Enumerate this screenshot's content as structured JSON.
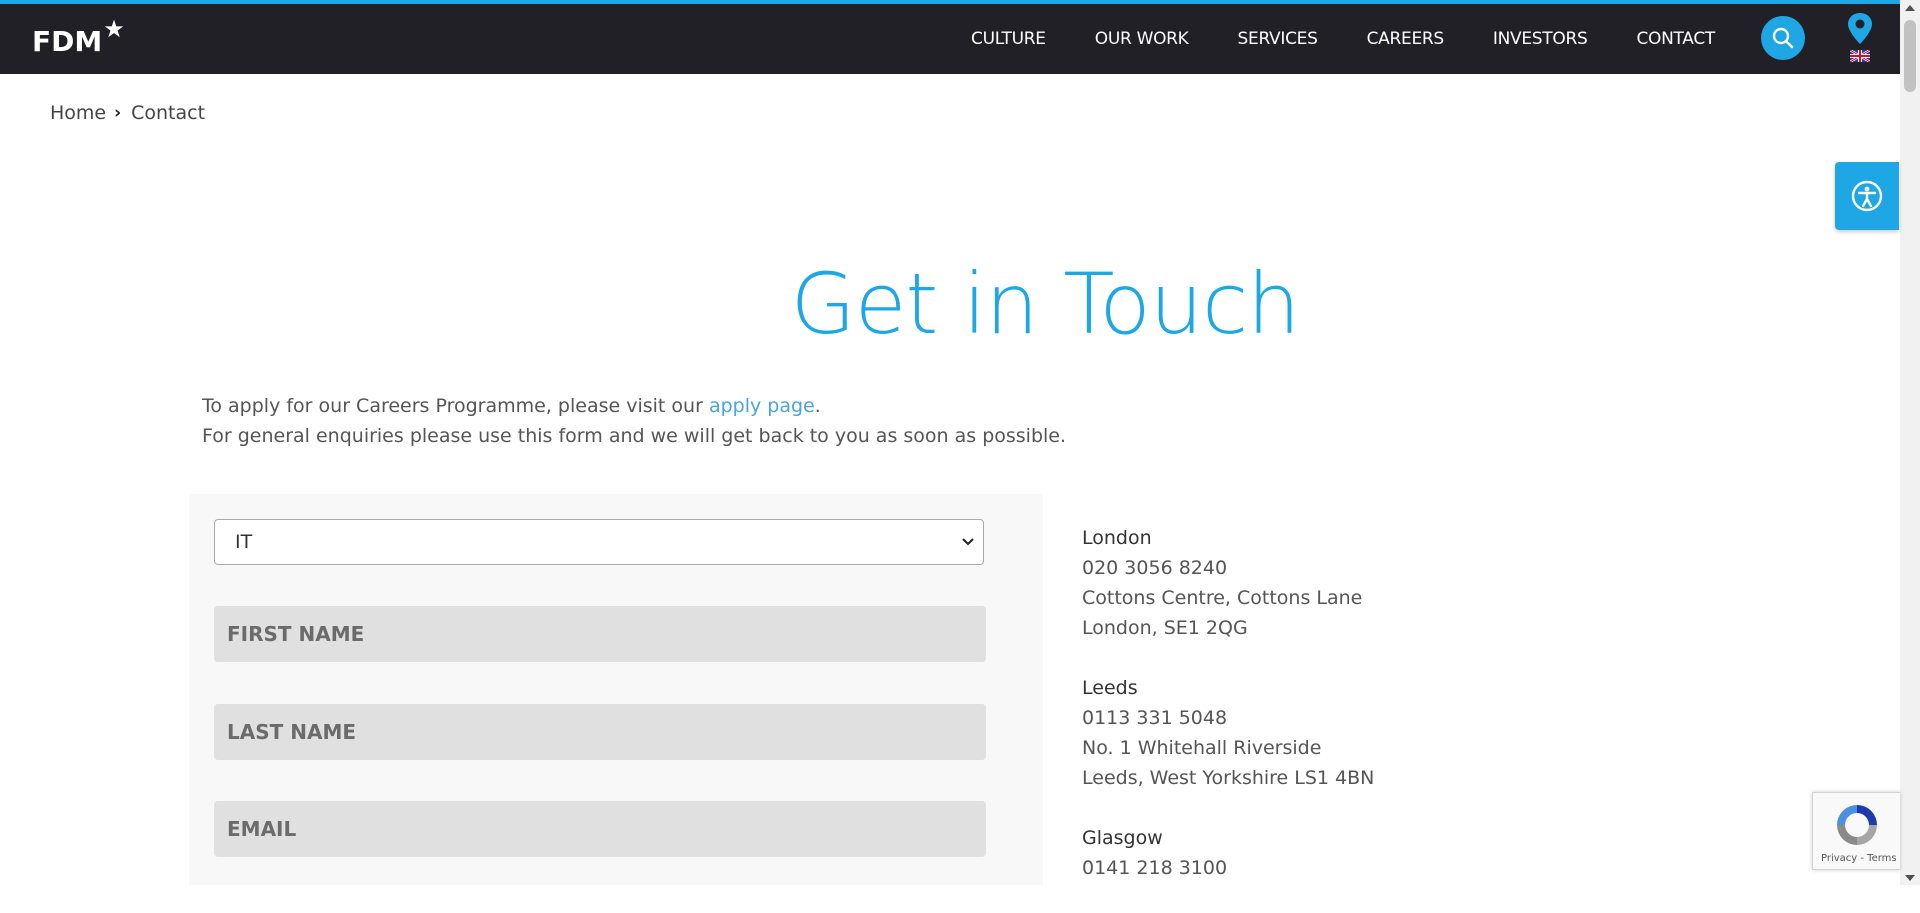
{
  "header": {
    "logo_text": "FDM",
    "nav": [
      "CULTURE",
      "OUR WORK",
      "SERVICES",
      "CAREERS",
      "INVESTORS",
      "CONTACT"
    ],
    "icons": [
      "search-icon",
      "location-pin-icon",
      "uk-flag-icon"
    ]
  },
  "breadcrumb": {
    "home": "Home",
    "current": "Contact"
  },
  "accessibility": {
    "icon": "accessibility-icon"
  },
  "main": {
    "title": "Get in Touch",
    "intro_line1_prefix": "To apply for our Careers Programme, please visit our ",
    "intro_link": "apply page",
    "intro_line1_suffix": ".",
    "intro_line2": "For general enquiries please use this form and we will get back to you as soon as possible."
  },
  "form": {
    "department_select": "IT",
    "first_name_placeholder": "FIRST NAME",
    "last_name_placeholder": "LAST NAME",
    "email_placeholder": "EMAIL"
  },
  "offices": [
    {
      "city": "London",
      "phone": "020 3056 8240",
      "line1": "Cottons Centre, Cottons Lane",
      "line2": "London, SE1 2QG"
    },
    {
      "city": "Leeds",
      "phone": "0113 331 5048",
      "line1": "No. 1 Whitehall Riverside",
      "line2": "Leeds, West Yorkshire LS1 4BN"
    },
    {
      "city": "Glasgow",
      "phone": "0141 218 3100"
    }
  ],
  "recaptcha": {
    "terms": "Privacy - Terms"
  },
  "colors": {
    "accent": "#1ea7e4",
    "navbar": "#202026",
    "link": "#4ba3e0"
  }
}
